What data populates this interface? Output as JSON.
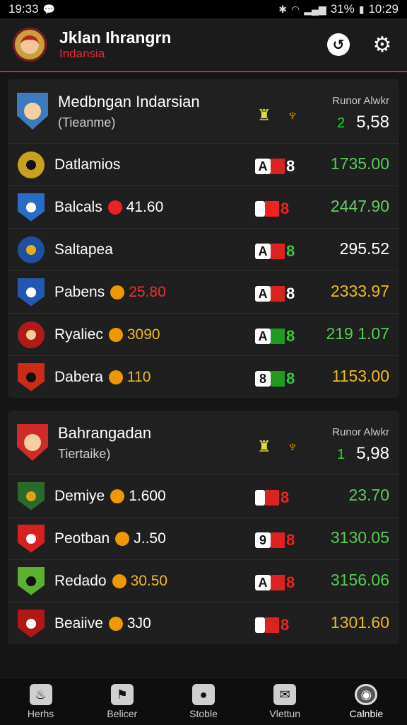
{
  "status": {
    "time_left": "19:33",
    "battery": "31%",
    "time_right": "10:29"
  },
  "app": {
    "title": "Jklan Ihrangrn",
    "subtitle": "Indansia"
  },
  "sections": [
    {
      "title": "Medbngan Indarsian",
      "subtitle": "(Tieanme)",
      "cap": "Runor Alwkr",
      "pre": "2",
      "value": "5,58",
      "crest_color": "#3d7ac0",
      "rows": [
        {
          "team": "Datlamios",
          "odd": "",
          "odd_color": "",
          "sym": "A",
          "bar": "#d22",
          "num": "8",
          "num_color": "#fff",
          "score": "1735.00",
          "score_color": "#5c5",
          "badge": "#c9a020",
          "badge_shape": "round",
          "dot": "#111"
        },
        {
          "team": "Balcals",
          "odd": "41.60",
          "odd_color": "#fff",
          "mark": "#e22",
          "sym": "",
          "bar": "#e22",
          "num": "8",
          "num_color": "#e22",
          "score": "2447.90",
          "score_color": "#6c6",
          "badge": "#2a6bc4",
          "badge_shape": "shield",
          "dot": "#fff"
        },
        {
          "team": "Saltapea",
          "odd": "",
          "odd_color": "",
          "sym": "A",
          "bar": "#d22",
          "num": "8",
          "num_color": "#3c3",
          "score": "295.52",
          "score_color": "#fff",
          "badge": "#1f4fa0",
          "badge_shape": "round",
          "dot": "#e0b020"
        },
        {
          "team": "Pabens",
          "odd": "25.80",
          "odd_color": "#e33",
          "mark": "#e90",
          "sym": "A",
          "bar": "#d22",
          "num": "8",
          "num_color": "#fff",
          "score": "2333.97",
          "score_color": "#eb2",
          "badge": "#2458b0",
          "badge_shape": "shield",
          "dot": "#fff"
        },
        {
          "team": "Ryaliec",
          "odd": "3090",
          "odd_color": "#eb2",
          "mark": "#e90",
          "sym": "A",
          "bar": "#292",
          "num": "8",
          "num_color": "#3c3",
          "score": "219 1.07",
          "score_color": "#5c5",
          "badge": "#b01a1a",
          "badge_shape": "round",
          "dot": "#f0d090"
        },
        {
          "team": "Dabera",
          "odd": "110",
          "odd_color": "#eb2",
          "mark": "#e90",
          "sym": "8",
          "bar": "#292",
          "num": "8",
          "num_color": "#3c3",
          "score": "1153.00",
          "score_color": "#eb2",
          "badge": "#cc2a1a",
          "badge_shape": "shield",
          "dot": "#111"
        }
      ]
    },
    {
      "title": "Bahrangadan",
      "subtitle": "Tiertaike)",
      "cap": "Runor Alwkr",
      "pre": "1",
      "value": "5,98",
      "crest_color": "#d02a2a",
      "rows": [
        {
          "team": "Demiye",
          "odd": "1.600",
          "odd_color": "#fff",
          "mark": "#e90",
          "sym": "",
          "bar": "#d22",
          "num": "8",
          "num_color": "#e22",
          "score": "23.70",
          "score_color": "#5c5",
          "badge": "#2a6a2a",
          "badge_shape": "shield",
          "dot": "#e0a020"
        },
        {
          "team": "Peotban",
          "odd": "J..50",
          "odd_color": "#fff",
          "mark": "#e90",
          "sym": "9",
          "bar": "#d22",
          "num": "8",
          "num_color": "#e22",
          "score": "3130.05",
          "score_color": "#5c5",
          "badge": "#d82020",
          "badge_shape": "shield",
          "dot": "#fff"
        },
        {
          "team": "Redado",
          "odd": "30.50",
          "odd_color": "#eb2",
          "mark": "#e90",
          "sym": "A",
          "bar": "#d22",
          "num": "8",
          "num_color": "#e22",
          "score": "3156.06",
          "score_color": "#5c5",
          "badge": "#5cb030",
          "badge_shape": "shield",
          "dot": "#111"
        },
        {
          "team": "Beaiive",
          "odd": "3J0",
          "odd_color": "#fff",
          "mark": "#e90",
          "sym": "",
          "bar": "#d22",
          "num": "8",
          "num_color": "#e22",
          "score": "1301.60",
          "score_color": "#eb2",
          "badge": "#b01818",
          "badge_shape": "shield",
          "dot": "#fff"
        }
      ]
    }
  ],
  "nav": [
    {
      "label": "Herhs",
      "icon": "fire-icon"
    },
    {
      "label": "Belicer",
      "icon": "flag-icon"
    },
    {
      "label": "Stoble",
      "icon": "ball-icon"
    },
    {
      "label": "Vlettun",
      "icon": "inbox-icon"
    },
    {
      "label": "Calnbie",
      "icon": "profile-icon",
      "active": true
    }
  ]
}
